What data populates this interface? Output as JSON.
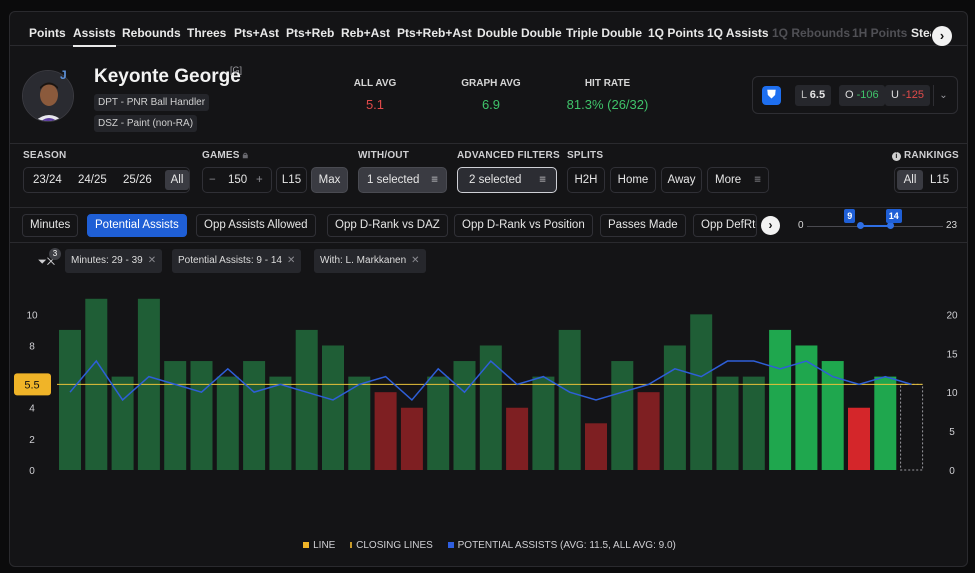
{
  "tabs": [
    {
      "label": "Points",
      "state": "normal"
    },
    {
      "label": "Assists",
      "state": "active"
    },
    {
      "label": "Rebounds",
      "state": "normal"
    },
    {
      "label": "Threes",
      "state": "normal"
    },
    {
      "label": "Pts+Ast",
      "state": "normal"
    },
    {
      "label": "Pts+Reb",
      "state": "normal"
    },
    {
      "label": "Reb+Ast",
      "state": "normal"
    },
    {
      "label": "Pts+Reb+Ast",
      "state": "normal"
    },
    {
      "label": "Double Double",
      "state": "normal"
    },
    {
      "label": "Triple Double",
      "state": "normal"
    },
    {
      "label": "1Q Points",
      "state": "normal"
    },
    {
      "label": "1Q Assists",
      "state": "normal"
    },
    {
      "label": "1Q Rebounds",
      "state": "dim"
    },
    {
      "label": "1H Points",
      "state": "dim"
    },
    {
      "label": "Steals",
      "state": "normal"
    }
  ],
  "player": {
    "name": "Keyonte George",
    "position": "[G]",
    "tags": [
      "DPT - PNR Ball Handler",
      "DSZ - Paint (non-RA)"
    ]
  },
  "stats": [
    {
      "label": "ALL AVG",
      "value": "5.1",
      "color": "#e04a4a"
    },
    {
      "label": "GRAPH AVG",
      "value": "6.9",
      "color": "#3fc36a"
    },
    {
      "label": "HIT RATE",
      "value": "81.3% (26/32)",
      "color": "#3fc36a"
    }
  ],
  "odds": {
    "book_icon": "fanduel-shield-icon",
    "line_label": "L",
    "line": "6.5",
    "over_label": "O",
    "over": "-106",
    "under_label": "U",
    "under": "-125",
    "expand_icon": "chevron-down-icon"
  },
  "filters": {
    "season": {
      "label": "SEASON",
      "options": [
        "23/24",
        "24/25",
        "25/26",
        "All"
      ],
      "selected": "All"
    },
    "games": {
      "label": "GAMES",
      "lock_icon": "lock-icon",
      "minus": "−",
      "value": "150",
      "plus": "+",
      "options": [
        "L15",
        "Max"
      ],
      "selected": "Max"
    },
    "with_out": {
      "label": "WITH/OUT",
      "value": "1 selected"
    },
    "advanced": {
      "label": "ADVANCED FILTERS",
      "value": "2 selected"
    },
    "splits": {
      "label": "SPLITS",
      "options": [
        "H2H",
        "Home",
        "Away",
        "More"
      ]
    },
    "rankings": {
      "label": "RANKINGS",
      "info_icon": "info-icon",
      "options": [
        "All",
        "L15"
      ],
      "selected": "All"
    }
  },
  "stat_tabs": [
    "Minutes",
    "Potential Assists",
    "Opp Assists Allowed",
    "Opp D-Rank vs DAZ",
    "Opp D-Rank vs Position",
    "Passes Made",
    "Opp DefRtg"
  ],
  "stat_tab_selected": "Potential Assists",
  "slider": {
    "min": "0",
    "max": "23",
    "low": "9",
    "high": "14",
    "low_value": 9,
    "high_value": 14,
    "range_max": 23
  },
  "active_filters": {
    "count": "3",
    "chips": [
      "Minutes: 29 - 39",
      "Potential Assists: 9 - 14",
      "With: L. Markkanen"
    ]
  },
  "chart_data": {
    "type": "bar",
    "line_value": 5.5,
    "line_label": "5.5",
    "left_axis": {
      "ticks": [
        "0",
        "2",
        "4",
        "6",
        "8",
        "10"
      ],
      "ylim": [
        0,
        11.5
      ]
    },
    "right_axis": {
      "ticks": [
        "0",
        "5",
        "10",
        "15",
        "20"
      ],
      "ylim": [
        0,
        23
      ]
    },
    "values": [
      9,
      11,
      6,
      11,
      7,
      7,
      6,
      7,
      6,
      9,
      8,
      6,
      5,
      4,
      6,
      7,
      8,
      4,
      6,
      9,
      3,
      7,
      5,
      8,
      10,
      6,
      6,
      9,
      8,
      7,
      4,
      6
    ],
    "potential_assists": [
      10,
      14,
      9,
      12,
      11,
      10,
      13,
      10,
      11,
      10,
      9,
      11,
      12,
      9,
      13,
      10,
      14,
      11,
      12,
      10,
      9,
      10,
      11,
      13,
      12,
      14,
      14,
      13,
      14,
      12,
      11,
      12,
      11
    ],
    "colors": {
      "hit": "#1f5e36",
      "miss": "#7e1f22",
      "hit_recent": "#1fa74e",
      "miss_recent": "#d4262a",
      "line": "#e9c23a",
      "pa": "#2e5fd8"
    },
    "recent_from_index": 27
  },
  "legend": [
    {
      "label": "LINE",
      "color": "#f0b428"
    },
    {
      "label": "CLOSING LINES",
      "color": "#c89a2a"
    },
    {
      "label": "POTENTIAL ASSISTS (AVG: 11.5, ALL AVG: 9.0)",
      "color": "#2f5fe0"
    }
  ]
}
